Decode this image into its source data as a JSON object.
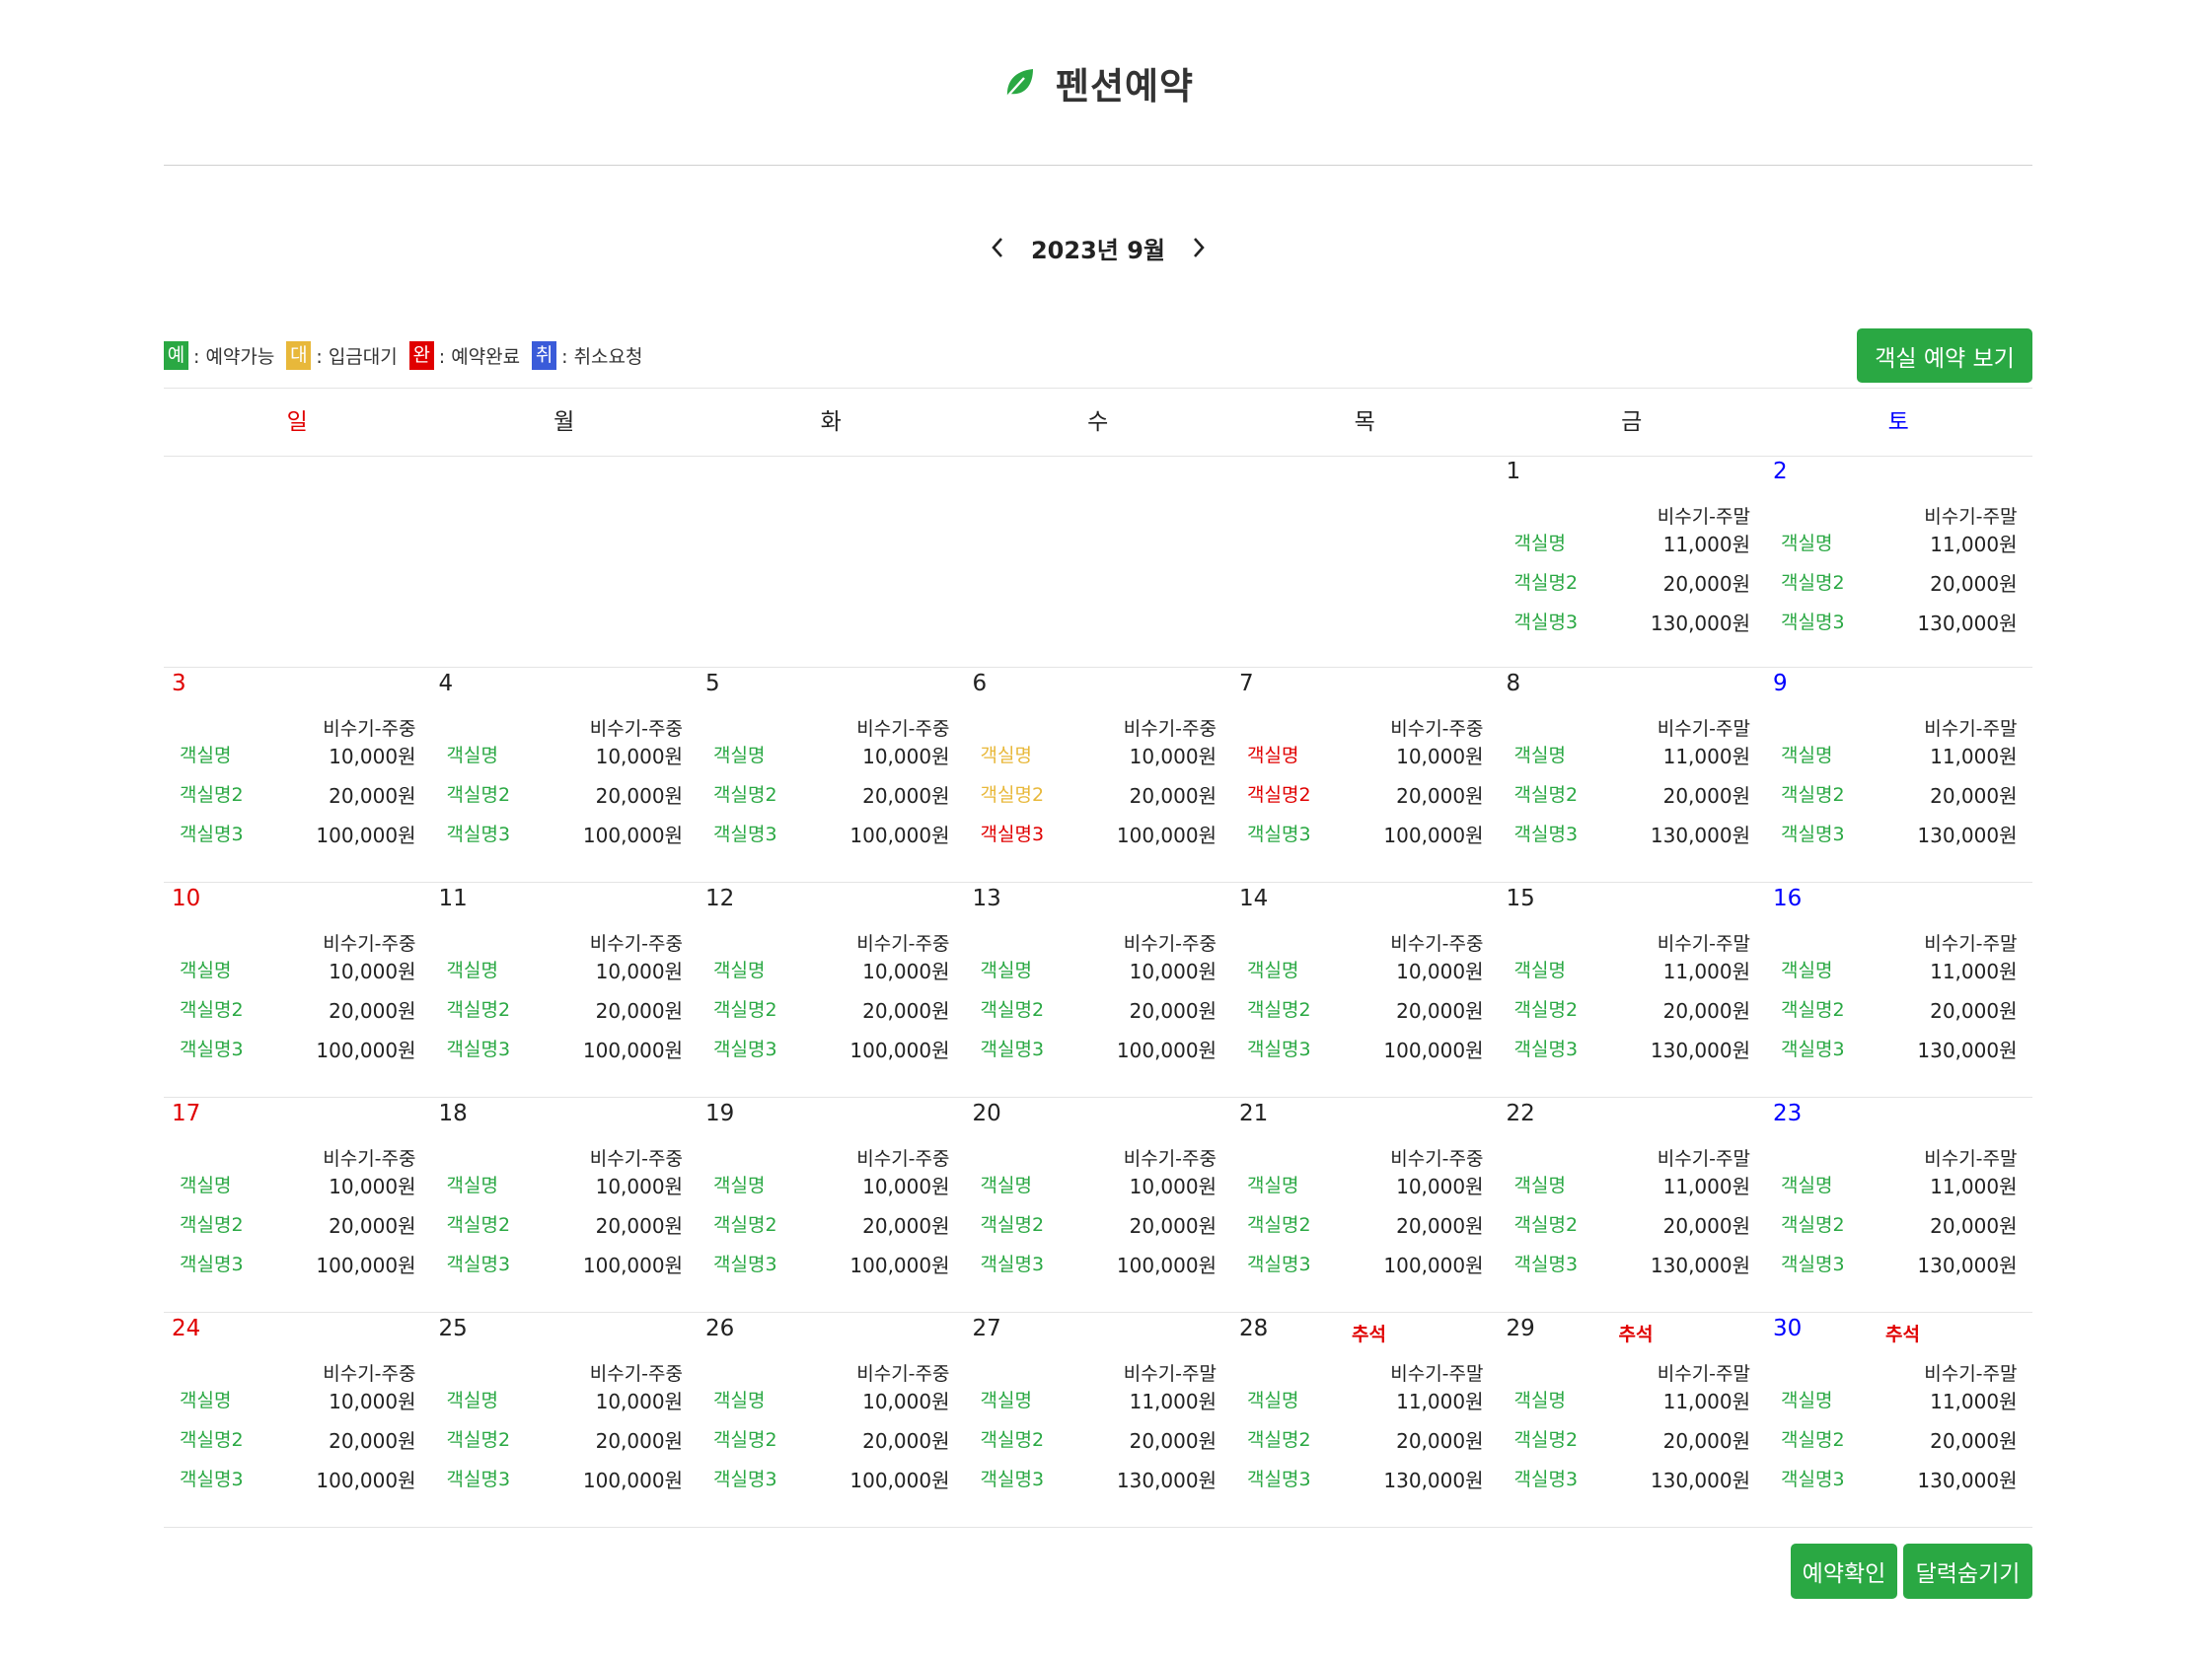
{
  "header": {
    "title": "펜션예약"
  },
  "nav": {
    "month_label": "2023년 9월"
  },
  "legend": [
    {
      "badge": "예",
      "text": ": 예약가능",
      "color": "#2aa843"
    },
    {
      "badge": "대",
      "text": ": 입금대기",
      "color": "#e8b83a"
    },
    {
      "badge": "완",
      "text": ": 예약완료",
      "color": "#e00000"
    },
    {
      "badge": "취",
      "text": ": 취소요청",
      "color": "#3a5bd9"
    }
  ],
  "buttons": {
    "view_rooms": "객실 예약 보기",
    "confirm": "예약확인",
    "hide_calendar": "달력숨기기"
  },
  "weekdays": [
    "일",
    "월",
    "화",
    "수",
    "목",
    "금",
    "토"
  ],
  "status_colors": {
    "available": "#2aa843",
    "pending": "#e8b83a",
    "booked": "#e00000",
    "cancel": "#3a5bd9"
  },
  "weeks": [
    [
      null,
      null,
      null,
      null,
      null,
      {
        "day": "1",
        "season": "비수기-주말",
        "holiday": "",
        "rooms": [
          {
            "name": "객실명",
            "price": "11,000원",
            "status": "available"
          },
          {
            "name": "객실명2",
            "price": "20,000원",
            "status": "available"
          },
          {
            "name": "객실명3",
            "price": "130,000원",
            "status": "available"
          }
        ]
      },
      {
        "day": "2",
        "season": "비수기-주말",
        "holiday": "",
        "rooms": [
          {
            "name": "객실명",
            "price": "11,000원",
            "status": "available"
          },
          {
            "name": "객실명2",
            "price": "20,000원",
            "status": "available"
          },
          {
            "name": "객실명3",
            "price": "130,000원",
            "status": "available"
          }
        ]
      }
    ],
    [
      {
        "day": "3",
        "season": "비수기-주중",
        "holiday": "",
        "rooms": [
          {
            "name": "객실명",
            "price": "10,000원",
            "status": "available"
          },
          {
            "name": "객실명2",
            "price": "20,000원",
            "status": "available"
          },
          {
            "name": "객실명3",
            "price": "100,000원",
            "status": "available"
          }
        ]
      },
      {
        "day": "4",
        "season": "비수기-주중",
        "holiday": "",
        "rooms": [
          {
            "name": "객실명",
            "price": "10,000원",
            "status": "available"
          },
          {
            "name": "객실명2",
            "price": "20,000원",
            "status": "available"
          },
          {
            "name": "객실명3",
            "price": "100,000원",
            "status": "available"
          }
        ]
      },
      {
        "day": "5",
        "season": "비수기-주중",
        "holiday": "",
        "rooms": [
          {
            "name": "객실명",
            "price": "10,000원",
            "status": "available"
          },
          {
            "name": "객실명2",
            "price": "20,000원",
            "status": "available"
          },
          {
            "name": "객실명3",
            "price": "100,000원",
            "status": "available"
          }
        ]
      },
      {
        "day": "6",
        "season": "비수기-주중",
        "holiday": "",
        "rooms": [
          {
            "name": "객실명",
            "price": "10,000원",
            "status": "pending"
          },
          {
            "name": "객실명2",
            "price": "20,000원",
            "status": "pending"
          },
          {
            "name": "객실명3",
            "price": "100,000원",
            "status": "booked"
          }
        ]
      },
      {
        "day": "7",
        "season": "비수기-주중",
        "holiday": "",
        "rooms": [
          {
            "name": "객실명",
            "price": "10,000원",
            "status": "booked"
          },
          {
            "name": "객실명2",
            "price": "20,000원",
            "status": "booked"
          },
          {
            "name": "객실명3",
            "price": "100,000원",
            "status": "available"
          }
        ]
      },
      {
        "day": "8",
        "season": "비수기-주말",
        "holiday": "",
        "rooms": [
          {
            "name": "객실명",
            "price": "11,000원",
            "status": "available"
          },
          {
            "name": "객실명2",
            "price": "20,000원",
            "status": "available"
          },
          {
            "name": "객실명3",
            "price": "130,000원",
            "status": "available"
          }
        ]
      },
      {
        "day": "9",
        "season": "비수기-주말",
        "holiday": "",
        "rooms": [
          {
            "name": "객실명",
            "price": "11,000원",
            "status": "available"
          },
          {
            "name": "객실명2",
            "price": "20,000원",
            "status": "available"
          },
          {
            "name": "객실명3",
            "price": "130,000원",
            "status": "available"
          }
        ]
      }
    ],
    [
      {
        "day": "10",
        "season": "비수기-주중",
        "holiday": "",
        "rooms": [
          {
            "name": "객실명",
            "price": "10,000원",
            "status": "available"
          },
          {
            "name": "객실명2",
            "price": "20,000원",
            "status": "available"
          },
          {
            "name": "객실명3",
            "price": "100,000원",
            "status": "available"
          }
        ]
      },
      {
        "day": "11",
        "season": "비수기-주중",
        "holiday": "",
        "rooms": [
          {
            "name": "객실명",
            "price": "10,000원",
            "status": "available"
          },
          {
            "name": "객실명2",
            "price": "20,000원",
            "status": "available"
          },
          {
            "name": "객실명3",
            "price": "100,000원",
            "status": "available"
          }
        ]
      },
      {
        "day": "12",
        "season": "비수기-주중",
        "holiday": "",
        "rooms": [
          {
            "name": "객실명",
            "price": "10,000원",
            "status": "available"
          },
          {
            "name": "객실명2",
            "price": "20,000원",
            "status": "available"
          },
          {
            "name": "객실명3",
            "price": "100,000원",
            "status": "available"
          }
        ]
      },
      {
        "day": "13",
        "season": "비수기-주중",
        "holiday": "",
        "rooms": [
          {
            "name": "객실명",
            "price": "10,000원",
            "status": "available"
          },
          {
            "name": "객실명2",
            "price": "20,000원",
            "status": "available"
          },
          {
            "name": "객실명3",
            "price": "100,000원",
            "status": "available"
          }
        ]
      },
      {
        "day": "14",
        "season": "비수기-주중",
        "holiday": "",
        "rooms": [
          {
            "name": "객실명",
            "price": "10,000원",
            "status": "available"
          },
          {
            "name": "객실명2",
            "price": "20,000원",
            "status": "available"
          },
          {
            "name": "객실명3",
            "price": "100,000원",
            "status": "available"
          }
        ]
      },
      {
        "day": "15",
        "season": "비수기-주말",
        "holiday": "",
        "rooms": [
          {
            "name": "객실명",
            "price": "11,000원",
            "status": "available"
          },
          {
            "name": "객실명2",
            "price": "20,000원",
            "status": "available"
          },
          {
            "name": "객실명3",
            "price": "130,000원",
            "status": "available"
          }
        ]
      },
      {
        "day": "16",
        "season": "비수기-주말",
        "holiday": "",
        "rooms": [
          {
            "name": "객실명",
            "price": "11,000원",
            "status": "available"
          },
          {
            "name": "객실명2",
            "price": "20,000원",
            "status": "available"
          },
          {
            "name": "객실명3",
            "price": "130,000원",
            "status": "available"
          }
        ]
      }
    ],
    [
      {
        "day": "17",
        "season": "비수기-주중",
        "holiday": "",
        "rooms": [
          {
            "name": "객실명",
            "price": "10,000원",
            "status": "available"
          },
          {
            "name": "객실명2",
            "price": "20,000원",
            "status": "available"
          },
          {
            "name": "객실명3",
            "price": "100,000원",
            "status": "available"
          }
        ]
      },
      {
        "day": "18",
        "season": "비수기-주중",
        "holiday": "",
        "rooms": [
          {
            "name": "객실명",
            "price": "10,000원",
            "status": "available"
          },
          {
            "name": "객실명2",
            "price": "20,000원",
            "status": "available"
          },
          {
            "name": "객실명3",
            "price": "100,000원",
            "status": "available"
          }
        ]
      },
      {
        "day": "19",
        "season": "비수기-주중",
        "holiday": "",
        "rooms": [
          {
            "name": "객실명",
            "price": "10,000원",
            "status": "available"
          },
          {
            "name": "객실명2",
            "price": "20,000원",
            "status": "available"
          },
          {
            "name": "객실명3",
            "price": "100,000원",
            "status": "available"
          }
        ]
      },
      {
        "day": "20",
        "season": "비수기-주중",
        "holiday": "",
        "rooms": [
          {
            "name": "객실명",
            "price": "10,000원",
            "status": "available"
          },
          {
            "name": "객실명2",
            "price": "20,000원",
            "status": "available"
          },
          {
            "name": "객실명3",
            "price": "100,000원",
            "status": "available"
          }
        ]
      },
      {
        "day": "21",
        "season": "비수기-주중",
        "holiday": "",
        "rooms": [
          {
            "name": "객실명",
            "price": "10,000원",
            "status": "available"
          },
          {
            "name": "객실명2",
            "price": "20,000원",
            "status": "available"
          },
          {
            "name": "객실명3",
            "price": "100,000원",
            "status": "available"
          }
        ]
      },
      {
        "day": "22",
        "season": "비수기-주말",
        "holiday": "",
        "rooms": [
          {
            "name": "객실명",
            "price": "11,000원",
            "status": "available"
          },
          {
            "name": "객실명2",
            "price": "20,000원",
            "status": "available"
          },
          {
            "name": "객실명3",
            "price": "130,000원",
            "status": "available"
          }
        ]
      },
      {
        "day": "23",
        "season": "비수기-주말",
        "holiday": "",
        "rooms": [
          {
            "name": "객실명",
            "price": "11,000원",
            "status": "available"
          },
          {
            "name": "객실명2",
            "price": "20,000원",
            "status": "available"
          },
          {
            "name": "객실명3",
            "price": "130,000원",
            "status": "available"
          }
        ]
      }
    ],
    [
      {
        "day": "24",
        "season": "비수기-주중",
        "holiday": "",
        "rooms": [
          {
            "name": "객실명",
            "price": "10,000원",
            "status": "available"
          },
          {
            "name": "객실명2",
            "price": "20,000원",
            "status": "available"
          },
          {
            "name": "객실명3",
            "price": "100,000원",
            "status": "available"
          }
        ]
      },
      {
        "day": "25",
        "season": "비수기-주중",
        "holiday": "",
        "rooms": [
          {
            "name": "객실명",
            "price": "10,000원",
            "status": "available"
          },
          {
            "name": "객실명2",
            "price": "20,000원",
            "status": "available"
          },
          {
            "name": "객실명3",
            "price": "100,000원",
            "status": "available"
          }
        ]
      },
      {
        "day": "26",
        "season": "비수기-주중",
        "holiday": "",
        "rooms": [
          {
            "name": "객실명",
            "price": "10,000원",
            "status": "available"
          },
          {
            "name": "객실명2",
            "price": "20,000원",
            "status": "available"
          },
          {
            "name": "객실명3",
            "price": "100,000원",
            "status": "available"
          }
        ]
      },
      {
        "day": "27",
        "season": "비수기-주말",
        "holiday": "",
        "rooms": [
          {
            "name": "객실명",
            "price": "11,000원",
            "status": "available"
          },
          {
            "name": "객실명2",
            "price": "20,000원",
            "status": "available"
          },
          {
            "name": "객실명3",
            "price": "130,000원",
            "status": "available"
          }
        ]
      },
      {
        "day": "28",
        "season": "비수기-주말",
        "holiday": "추석",
        "rooms": [
          {
            "name": "객실명",
            "price": "11,000원",
            "status": "available"
          },
          {
            "name": "객실명2",
            "price": "20,000원",
            "status": "available"
          },
          {
            "name": "객실명3",
            "price": "130,000원",
            "status": "available"
          }
        ]
      },
      {
        "day": "29",
        "season": "비수기-주말",
        "holiday": "추석",
        "rooms": [
          {
            "name": "객실명",
            "price": "11,000원",
            "status": "available"
          },
          {
            "name": "객실명2",
            "price": "20,000원",
            "status": "available"
          },
          {
            "name": "객실명3",
            "price": "130,000원",
            "status": "available"
          }
        ]
      },
      {
        "day": "30",
        "season": "비수기-주말",
        "holiday": "추석",
        "rooms": [
          {
            "name": "객실명",
            "price": "11,000원",
            "status": "available"
          },
          {
            "name": "객실명2",
            "price": "20,000원",
            "status": "available"
          },
          {
            "name": "객실명3",
            "price": "130,000원",
            "status": "available"
          }
        ]
      }
    ]
  ]
}
